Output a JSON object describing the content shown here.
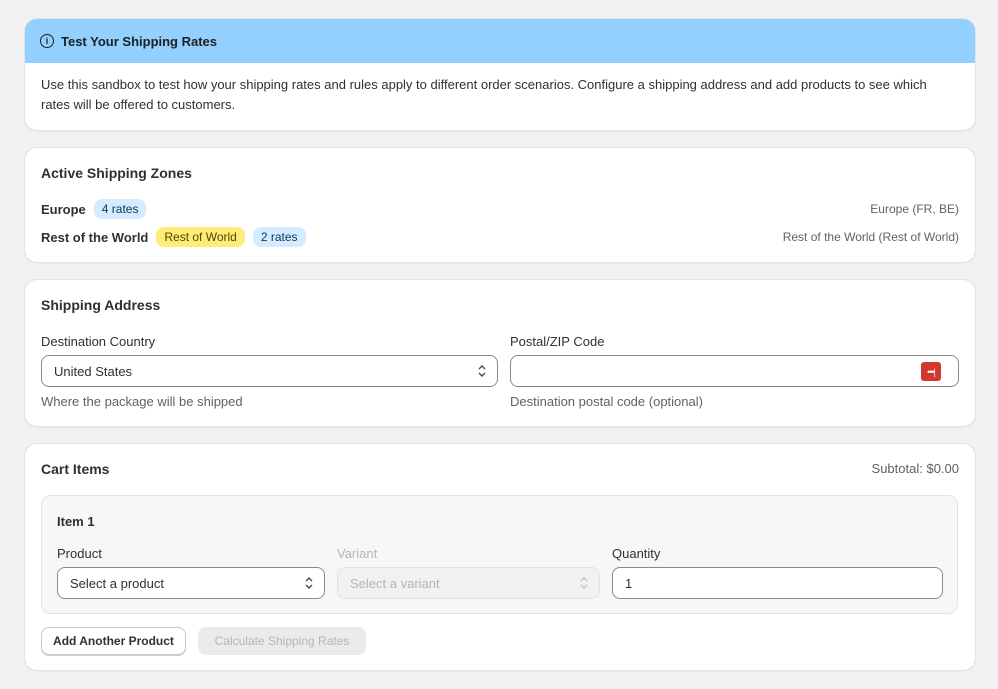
{
  "banner": {
    "title": "Test Your Shipping Rates",
    "icon": "info-icon",
    "description": "Use this sandbox to test how your shipping rates and rules apply to different order scenarios. Configure a shipping address and add products to see which rates will be offered to customers."
  },
  "zones": {
    "title": "Active Shipping Zones",
    "items": [
      {
        "name": "Europe",
        "tag": "",
        "rates": "4 rates",
        "region": "Europe (FR, BE)"
      },
      {
        "name": "Rest of the World",
        "tag": "Rest of World",
        "rates": "2 rates",
        "region": "Rest of the World (Rest of World)"
      }
    ]
  },
  "address": {
    "title": "Shipping Address",
    "country_label": "Destination Country",
    "country_value": "United States",
    "country_help": "Where the package will be shipped",
    "postal_label": "Postal/ZIP Code",
    "postal_value": "",
    "postal_help": "Destination postal code (optional)"
  },
  "cart": {
    "title": "Cart Items",
    "subtotal": "Subtotal: $0.00",
    "items": [
      {
        "title": "Item 1",
        "product_label": "Product",
        "product_value": "Select a product",
        "variant_label": "Variant",
        "variant_value": "Select a variant",
        "quantity_label": "Quantity",
        "quantity_value": "1"
      }
    ],
    "add_button": "Add Another Product",
    "calculate_button": "Calculate Shipping Rates"
  },
  "colors": {
    "banner_bg": "#91d0ff",
    "badge_blue": "#d5ebff",
    "badge_yellow": "#ffeb78",
    "password_icon": "#d1382f"
  }
}
